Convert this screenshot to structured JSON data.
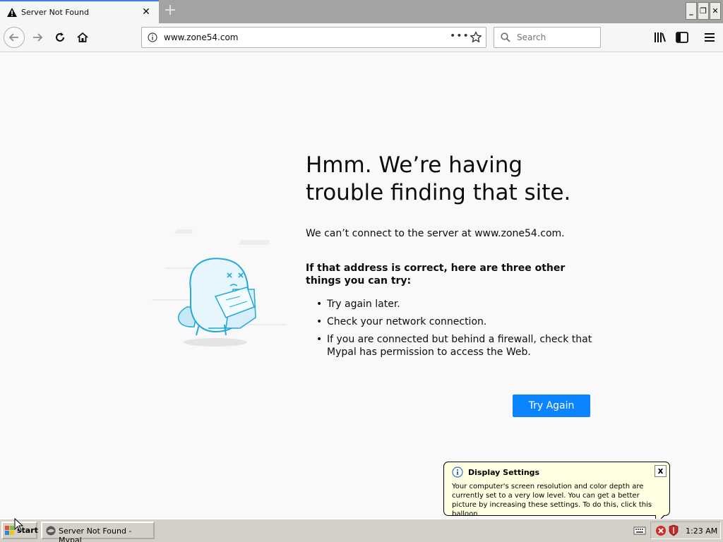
{
  "browser": {
    "tab": {
      "title": "Server Not Found"
    },
    "window_controls": {
      "minimize": "_",
      "restore": "❐",
      "close": "✕"
    },
    "url": "www.zone54.com",
    "search_placeholder": "Search"
  },
  "error_page": {
    "title": "Hmm. We’re having trouble finding that site.",
    "description": "We can’t connect to the server at www.zone54.com.",
    "suggestions_heading": "If that address is correct, here are three other things you can try:",
    "suggestions": [
      "Try again later.",
      "Check your network connection.",
      "If you are connected but behind a firewall, check that Mypal has permission to access the Web."
    ],
    "try_again_label": "Try Again"
  },
  "balloon": {
    "title": "Display Settings",
    "close": "x",
    "text": "Your computer's screen resolution and color depth are currently set to a very low level. You can get a better picture by increasing these settings. To do this, click this balloon."
  },
  "taskbar": {
    "start_label": "start",
    "task_label": "Server Not Found - Mypal",
    "clock": "1:23 AM"
  },
  "colors": {
    "accent": "#0a84ff",
    "tab_highlight": "#3b7fe4",
    "balloon_bg": "#ffffe1",
    "taskbar_bg": "#d4d0c8"
  }
}
